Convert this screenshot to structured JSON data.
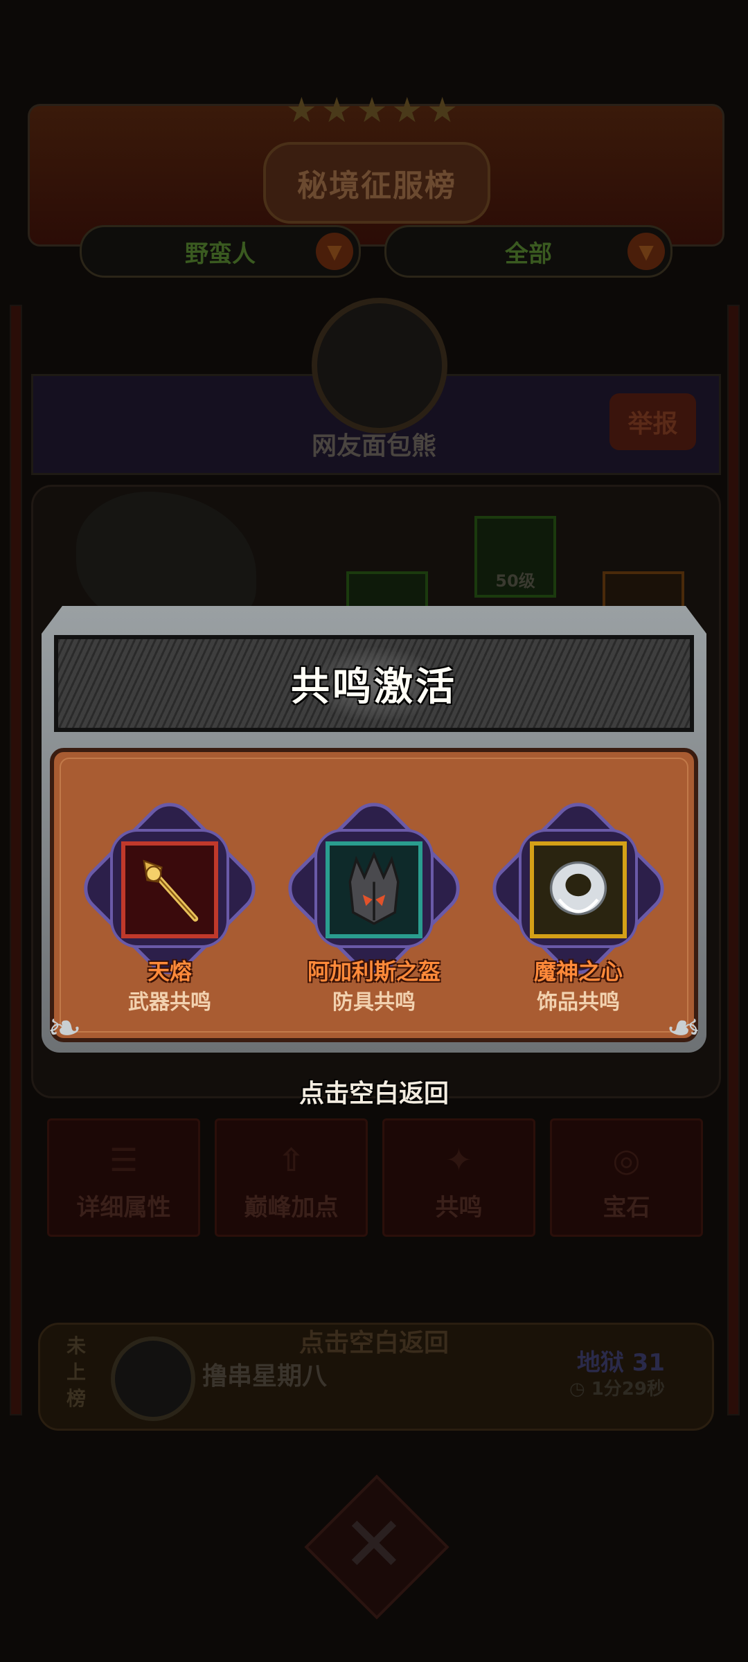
{
  "background": {
    "title": "秘境征服榜",
    "class_filter": "野蛮人",
    "scope_filter": "全部",
    "player_name": "网友面包熊",
    "report_label": "举报",
    "slot_level": "50级",
    "tabs": [
      {
        "label": "详细属性",
        "icon": "list-icon"
      },
      {
        "label": "巅峰加点",
        "icon": "arrow-up-icon"
      },
      {
        "label": "共鸣",
        "icon": "resonance-icon"
      },
      {
        "label": "宝石",
        "icon": "gem-icon"
      }
    ],
    "my_rank": {
      "status": "未上榜",
      "name": "撸串星期八",
      "hint": "点击空白返回",
      "level": "地狱 31",
      "time": "1分29秒"
    }
  },
  "popup": {
    "title": "共鸣激活",
    "items": [
      {
        "name": "天熔",
        "type": "武器共鸣",
        "frame_color": "#c0392b",
        "icon": "mace-icon"
      },
      {
        "name": "阿加利斯之盔",
        "type": "防具共鸣",
        "frame_color": "#2a9d8f",
        "icon": "helmet-icon"
      },
      {
        "name": "魔神之心",
        "type": "饰品共鸣",
        "frame_color": "#d4a017",
        "icon": "amulet-icon"
      }
    ],
    "close_hint": "点击空白返回"
  }
}
